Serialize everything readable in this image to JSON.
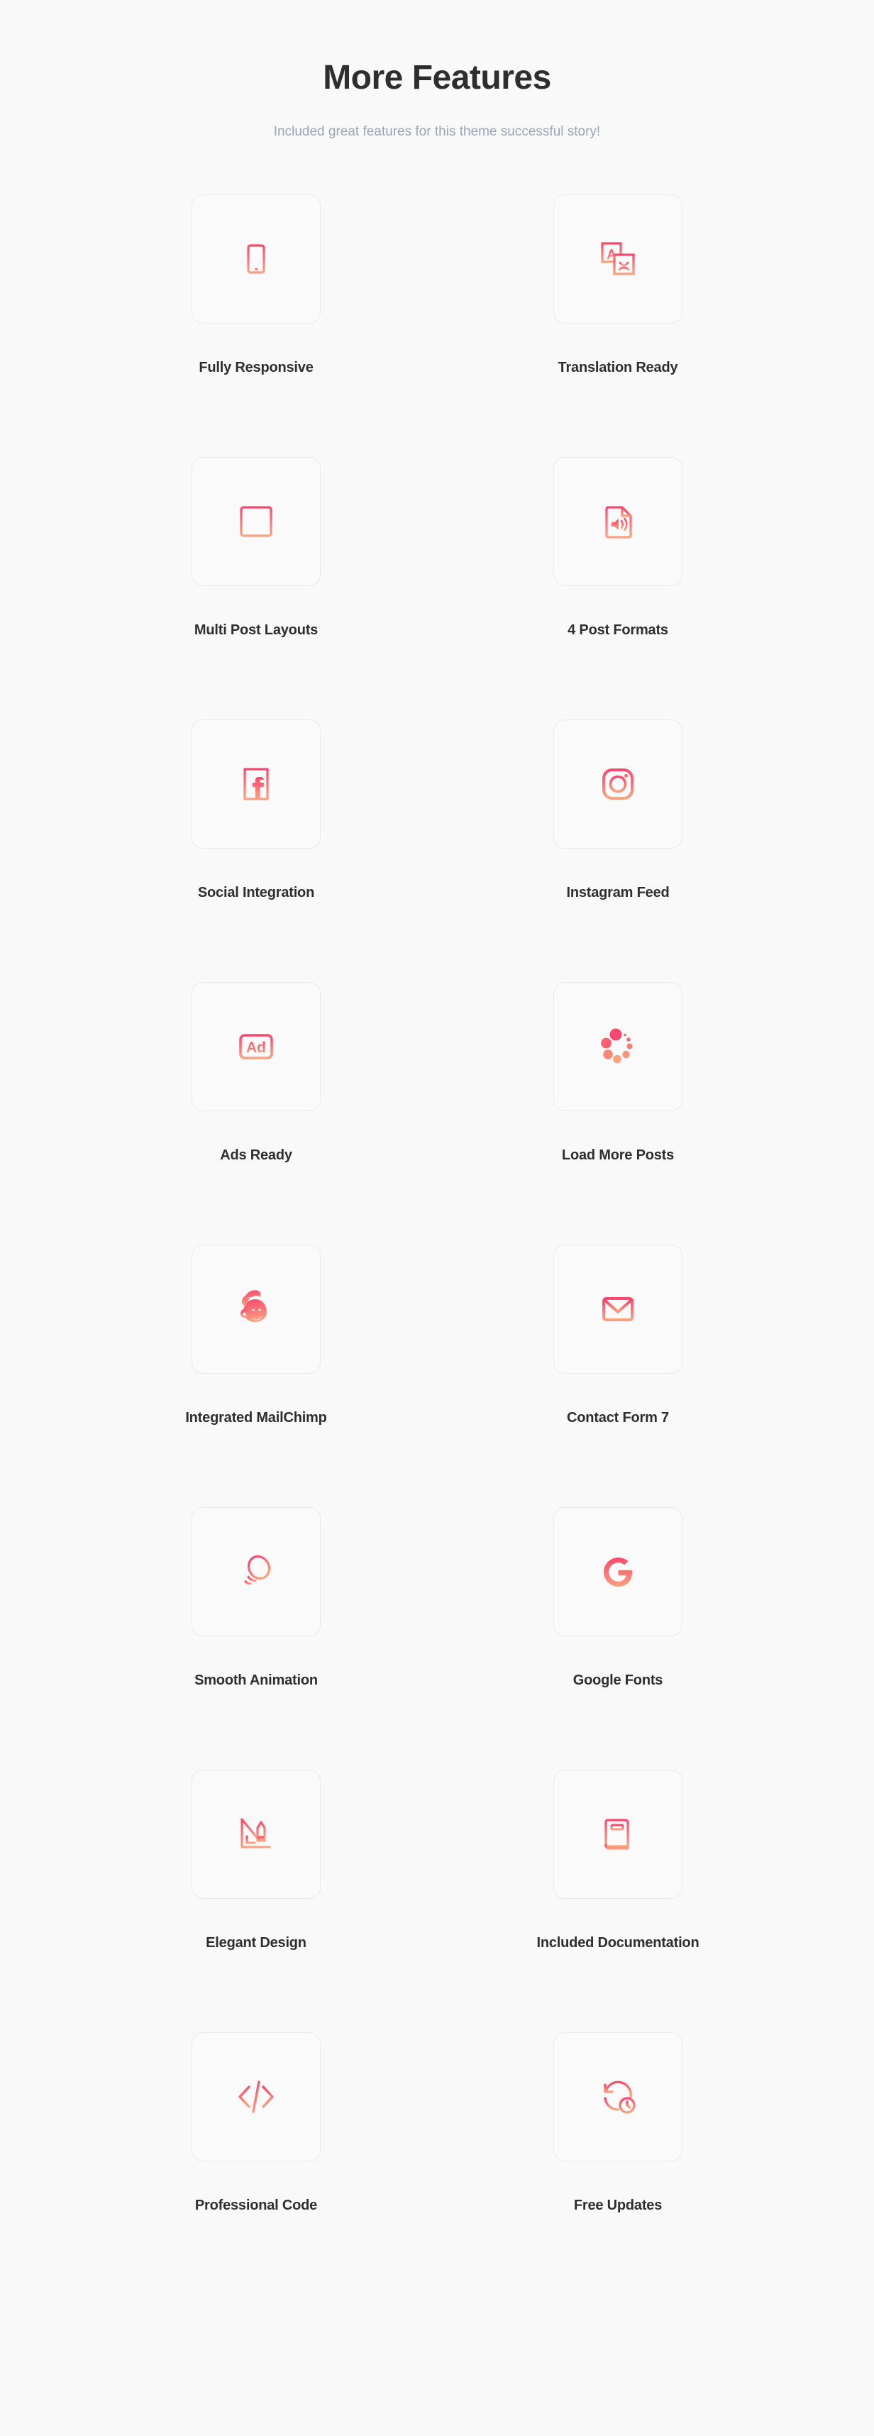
{
  "header": {
    "title": "More Features",
    "subtitle": "Included great features for this theme successful story!"
  },
  "theme": {
    "background": "#f9f9fa",
    "title_color": "#2e2e2e",
    "subtitle_color": "#9aa5b5",
    "icon_gradient_start": "#f9486d",
    "icon_gradient_end": "#fca17f",
    "box_border": "#e9eaec"
  },
  "features": [
    {
      "label": "Fully Responsive",
      "icon": "mobile-phone-icon"
    },
    {
      "label": "Translation Ready",
      "icon": "translate-icon"
    },
    {
      "label": "Multi Post Layouts",
      "icon": "newspaper-layout-icon"
    },
    {
      "label": "4 Post Formats",
      "icon": "audio-document-icon"
    },
    {
      "label": "Social Integration",
      "icon": "facebook-icon"
    },
    {
      "label": "Instagram Feed",
      "icon": "instagram-icon"
    },
    {
      "label": "Ads Ready",
      "icon": "ad-badge-icon"
    },
    {
      "label": "Load More Posts",
      "icon": "loading-spinner-icon"
    },
    {
      "label": "Integrated MailChimp",
      "icon": "mailchimp-icon"
    },
    {
      "label": "Contact Form 7",
      "icon": "envelope-icon"
    },
    {
      "label": "Smooth Animation",
      "icon": "motion-trail-icon"
    },
    {
      "label": "Google Fonts",
      "icon": "google-g-icon"
    },
    {
      "label": "Elegant Design",
      "icon": "ruler-pencil-icon"
    },
    {
      "label": "Included Documentation",
      "icon": "book-icon"
    },
    {
      "label": "Professional Code",
      "icon": "code-brackets-icon"
    },
    {
      "label": "Free Updates",
      "icon": "history-clock-icon"
    }
  ]
}
